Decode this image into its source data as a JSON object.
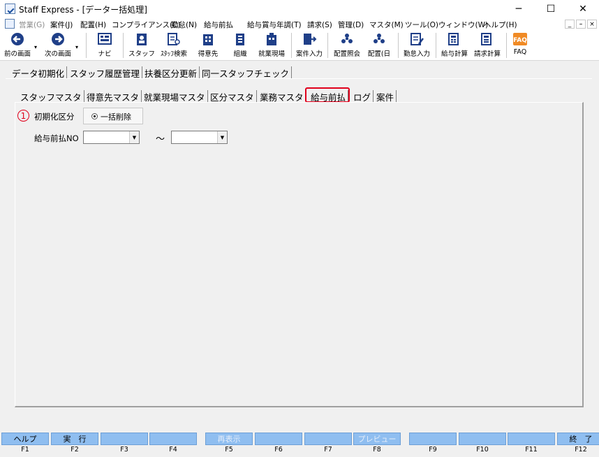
{
  "window": {
    "title": "Staff Express - [データー括処理]",
    "controls": {
      "minimize": "─",
      "maximize": "☐",
      "close": "✕"
    }
  },
  "menu": {
    "items": [
      {
        "label": "営業(G)",
        "disabled": true
      },
      {
        "label": "案件(J)"
      },
      {
        "label": "配置(H)"
      },
      {
        "label": "コンプライアンス(C)"
      },
      {
        "label": "勤怠(N)"
      },
      {
        "label": "給与前払"
      },
      {
        "label": "給与賞与年調(T)"
      },
      {
        "label": "請求(S)"
      },
      {
        "label": "管理(D)"
      },
      {
        "label": "マスタ(M)"
      },
      {
        "label": "ツール(O)"
      },
      {
        "label": "ウィンドウ(W)"
      },
      {
        "label": "ヘルプ(H)"
      }
    ],
    "mdi": {
      "minimize": "_",
      "restore": "ｰ",
      "close": "×"
    }
  },
  "toolbar": {
    "buttons": [
      {
        "label": "前の画面",
        "icon": "back-arrow-icon"
      },
      {
        "label": "次の画面",
        "icon": "forward-arrow-icon"
      },
      {
        "label": "ナビ",
        "icon": "navi-icon"
      },
      {
        "label": "スタッフ",
        "icon": "staff-icon"
      },
      {
        "label": "ｽﾀｯﾌ検索",
        "icon": "staff-search-icon"
      },
      {
        "label": "得意先",
        "icon": "client-icon"
      },
      {
        "label": "組織",
        "icon": "organization-icon"
      },
      {
        "label": "就業現場",
        "icon": "worksite-icon"
      },
      {
        "label": "案件入力",
        "icon": "case-input-icon"
      },
      {
        "label": "配置照会",
        "icon": "placement-inquiry-icon"
      },
      {
        "label": "配置(日",
        "icon": "placement-daily-icon"
      },
      {
        "label": "勤怠入力",
        "icon": "attendance-input-icon"
      },
      {
        "label": "給与計算",
        "icon": "payroll-calc-icon"
      },
      {
        "label": "請求計算",
        "icon": "billing-calc-icon"
      },
      {
        "label": "FAQ",
        "icon": "faq-icon"
      }
    ],
    "dropdown_glyph": "▾"
  },
  "outer_tabs": [
    "データ初期化",
    "スタッフ履歴管理",
    "扶養区分更新",
    "同一スタッフチェック"
  ],
  "inner_tabs": [
    "スタッフマスタ",
    "得意先マスタ",
    "就業現場マスタ",
    "区分マスタ",
    "業務マスタ",
    "給与前払",
    "ログ",
    "案件"
  ],
  "inner_tab_selected": "給与前払",
  "form": {
    "step_marker": "1",
    "init_label": "初期化区分",
    "radio_label": "一括削除",
    "no_label": "給与前払NO",
    "range_separator": "～",
    "from_value": "",
    "to_value": ""
  },
  "function_keys": [
    {
      "label": "ヘルプ",
      "key": "F1",
      "disabled": false
    },
    {
      "label": "実　行",
      "key": "F2",
      "disabled": false
    },
    {
      "label": "",
      "key": "F3",
      "disabled": false
    },
    {
      "label": "",
      "key": "F4",
      "disabled": false
    },
    {
      "label": "再表示",
      "key": "F5",
      "disabled": true
    },
    {
      "label": "",
      "key": "F6",
      "disabled": false
    },
    {
      "label": "",
      "key": "F7",
      "disabled": false
    },
    {
      "label": "プレビュー",
      "key": "F8",
      "disabled": true
    },
    {
      "label": "",
      "key": "F9",
      "disabled": false
    },
    {
      "label": "",
      "key": "F10",
      "disabled": false
    },
    {
      "label": "",
      "key": "F11",
      "disabled": false
    },
    {
      "label": "終　了",
      "key": "F12",
      "disabled": false
    }
  ]
}
